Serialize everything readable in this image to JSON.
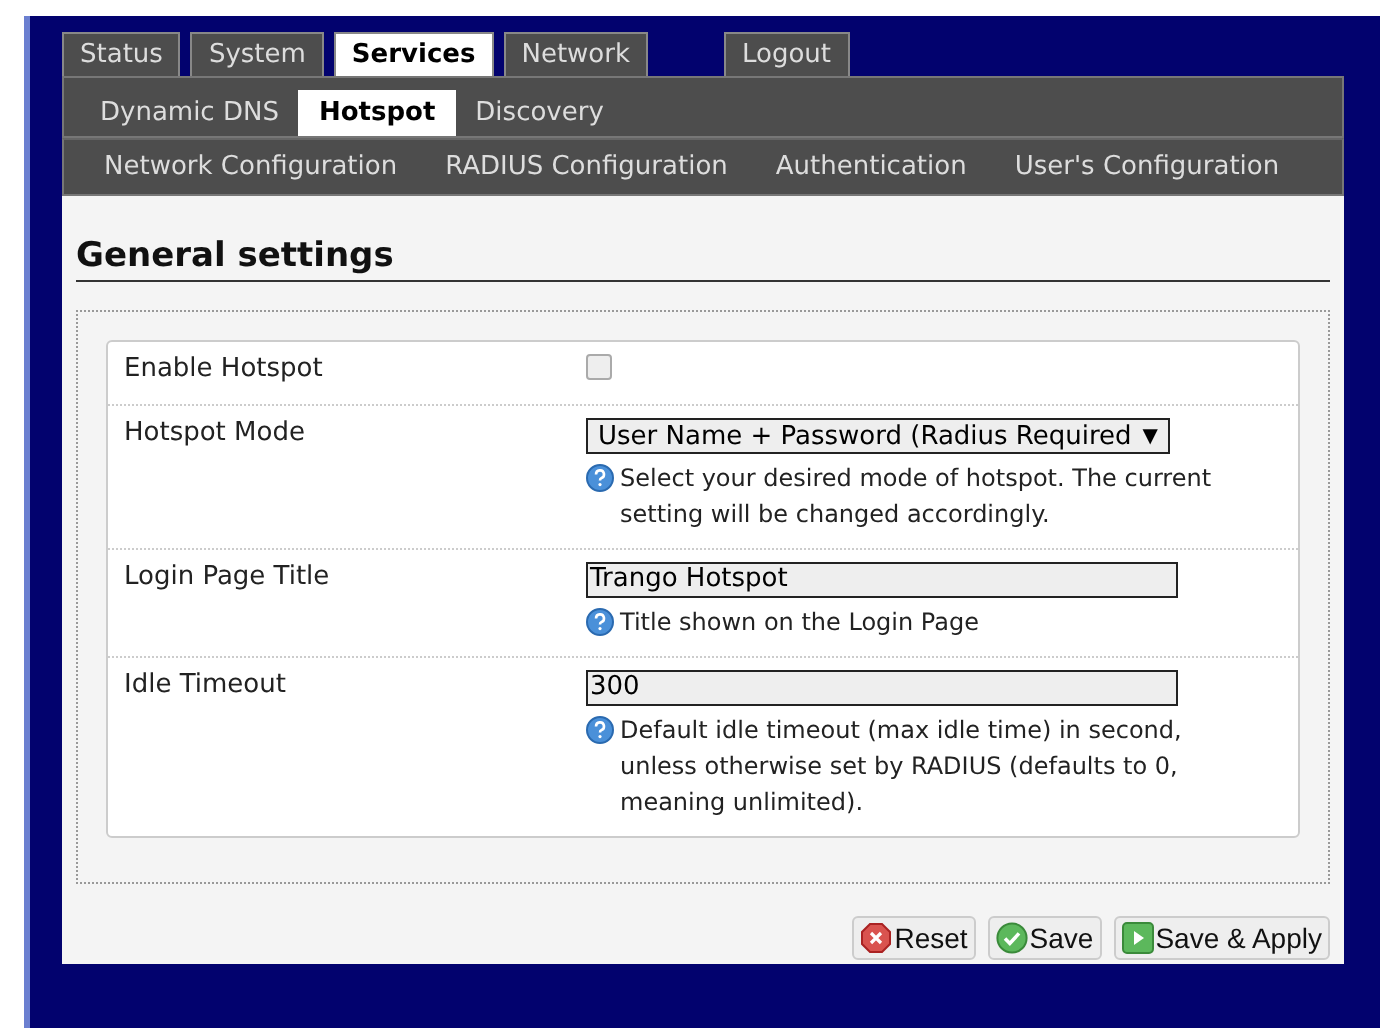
{
  "tabs": [
    {
      "label": "Status",
      "selected": false
    },
    {
      "label": "System",
      "selected": false
    },
    {
      "label": "Services",
      "selected": true
    },
    {
      "label": "Network",
      "selected": false
    },
    {
      "label": "Logout",
      "selected": false
    }
  ],
  "subtabs": [
    {
      "label": "Dynamic DNS",
      "selected": false
    },
    {
      "label": "Hotspot",
      "selected": true
    },
    {
      "label": "Discovery",
      "selected": false
    }
  ],
  "sections": [
    {
      "label": "Network Configuration",
      "selected": false
    },
    {
      "label": "RADIUS Configuration",
      "selected": false
    },
    {
      "label": "Authentication",
      "selected": false
    },
    {
      "label": "User's Configuration",
      "selected": false
    }
  ],
  "heading": "General settings",
  "fields": [
    {
      "kind": "checkbox",
      "label": "Enable Hotspot",
      "checked": false
    },
    {
      "kind": "select",
      "label": "Hotspot Mode",
      "value": "User Name + Password (Radius Required",
      "caret": "▼",
      "help": "Select your desired mode of hotspot. The current setting will be changed accordingly."
    },
    {
      "kind": "text",
      "label": "Login Page Title",
      "value": "Trango Hotspot",
      "help": "Title shown on the Login Page"
    },
    {
      "kind": "text",
      "label": "Idle Timeout",
      "value": "300",
      "help": "Default idle timeout (max idle time) in second, unless otherwise set by RADIUS (defaults to 0, meaning unlimited)."
    }
  ],
  "buttons": [
    {
      "kind": "reset",
      "label": "Reset"
    },
    {
      "kind": "save",
      "label": "Save"
    },
    {
      "kind": "apply",
      "label": "Save & Apply"
    }
  ]
}
